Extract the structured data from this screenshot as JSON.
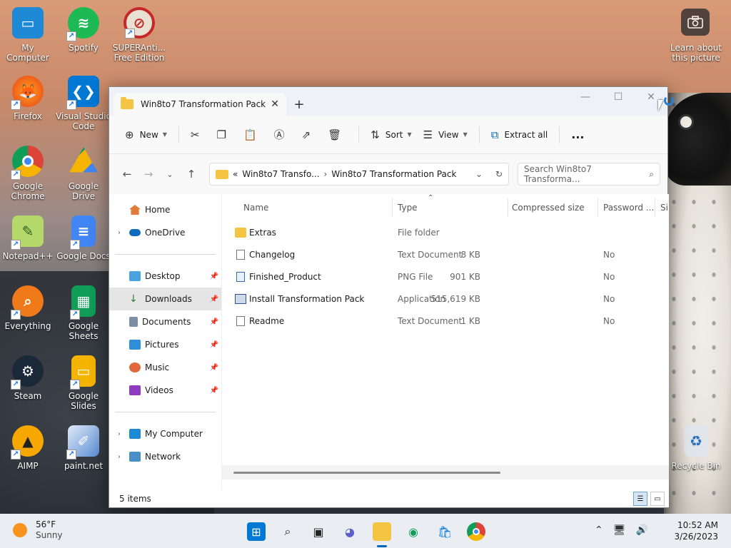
{
  "desktop": {
    "icons": [
      {
        "label": "My Computer"
      },
      {
        "label": "Spotify"
      },
      {
        "label": "SUPERAnti... Free Edition"
      },
      {
        "label": "Firefox"
      },
      {
        "label": "Visual Studio Code"
      },
      {
        "label": "Google Chrome"
      },
      {
        "label": "Google Drive"
      },
      {
        "label": "Notepad++"
      },
      {
        "label": "Google Docs"
      },
      {
        "label": "Everything"
      },
      {
        "label": "Google Sheets"
      },
      {
        "label": "Steam"
      },
      {
        "label": "Google Slides"
      },
      {
        "label": "AIMP"
      },
      {
        "label": "paint.net"
      },
      {
        "label": "Recycle Bin"
      }
    ],
    "learn_label": "Learn about this picture"
  },
  "window": {
    "tab_title": "Win8to7 Transformation Pack",
    "toolbar": {
      "new_label": "New",
      "sort_label": "Sort",
      "view_label": "View",
      "extract_label": "Extract all",
      "more_label": "..."
    },
    "address": {
      "prefix": "«",
      "crumb1": "Win8to7 Transfo...",
      "crumb2": "Win8to7 Transformation Pack"
    },
    "search_placeholder": "Search Win8to7 Transforma...",
    "sidebar": {
      "home": "Home",
      "onedrive": "OneDrive",
      "desktop": "Desktop",
      "downloads": "Downloads",
      "documents": "Documents",
      "pictures": "Pictures",
      "music": "Music",
      "videos": "Videos",
      "mycomputer": "My Computer",
      "network": "Network"
    },
    "columns": {
      "name": "Name",
      "type": "Type",
      "csize": "Compressed size",
      "password": "Password ...",
      "extra": "Si"
    },
    "files": [
      {
        "name": "Extras",
        "type": "File folder",
        "size": "",
        "password": ""
      },
      {
        "name": "Changelog",
        "type": "Text Document",
        "size": "8 KB",
        "password": "No"
      },
      {
        "name": "Finished_Product",
        "type": "PNG File",
        "size": "901 KB",
        "password": "No"
      },
      {
        "name": "Install Transformation Pack",
        "type": "Application",
        "size": "515,619 KB",
        "password": "No"
      },
      {
        "name": "Readme",
        "type": "Text Document",
        "size": "1 KB",
        "password": "No"
      }
    ],
    "status": "5 items"
  },
  "taskbar": {
    "temp": "56°F",
    "condition": "Sunny",
    "time": "10:52 AM",
    "date": "3/26/2023"
  },
  "colors": {
    "accent": "#0067c0",
    "folder": "#f4c542"
  }
}
